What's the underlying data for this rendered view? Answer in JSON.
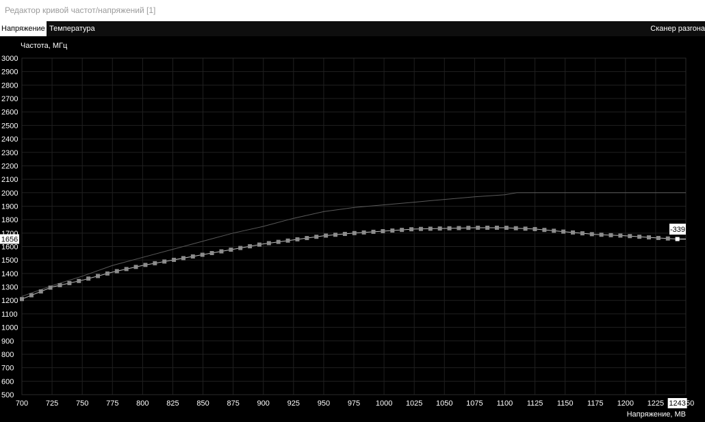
{
  "window": {
    "title": "Редактор кривой частот/напряжений [1]"
  },
  "tabs": {
    "voltage": "Напряжение",
    "temperature": "Температура",
    "scanner": "Сканер разгона"
  },
  "chart_data": {
    "type": "line",
    "ylabel": "Частота, МГц",
    "xlabel": "Напряжение, МВ",
    "xlim": [
      700,
      1250
    ],
    "ylim": [
      500,
      3000
    ],
    "x_ticks": [
      700,
      725,
      750,
      775,
      800,
      825,
      850,
      875,
      900,
      925,
      950,
      975,
      1000,
      1025,
      1050,
      1075,
      1100,
      1125,
      1150,
      1175,
      1200,
      1225,
      1250
    ],
    "y_ticks": [
      500,
      600,
      700,
      800,
      900,
      1000,
      1100,
      1200,
      1300,
      1400,
      1500,
      1600,
      1700,
      1800,
      1900,
      2000,
      2100,
      2200,
      2300,
      2400,
      2500,
      2600,
      2700,
      2800,
      2900,
      3000
    ],
    "grid": true,
    "series": [
      {
        "role": "default",
        "color": "#5a5a5a",
        "x": [
          700,
          725,
          750,
          775,
          800,
          825,
          850,
          875,
          900,
          925,
          950,
          975,
          1000,
          1025,
          1050,
          1075,
          1100,
          1110,
          1125,
          1150,
          1175,
          1200,
          1225,
          1250
        ],
        "y": [
          1230,
          1310,
          1380,
          1460,
          1520,
          1580,
          1640,
          1700,
          1750,
          1810,
          1860,
          1890,
          1910,
          1930,
          1950,
          1970,
          1985,
          2000,
          2000,
          2000,
          2000,
          2000,
          2000,
          2000
        ]
      },
      {
        "role": "curve",
        "color": "#bdbdbd",
        "point_color": "#8c8c8c",
        "x": [
          700,
          725,
          750,
          775,
          800,
          825,
          850,
          875,
          900,
          925,
          950,
          975,
          1000,
          1025,
          1050,
          1075,
          1100,
          1125,
          1150,
          1175,
          1200,
          1225,
          1243
        ],
        "y": [
          1210,
          1300,
          1350,
          1410,
          1460,
          1500,
          1540,
          1580,
          1620,
          1650,
          1680,
          1700,
          1715,
          1730,
          1735,
          1740,
          1740,
          1730,
          1710,
          1690,
          1680,
          1665,
          1656
        ]
      }
    ],
    "cursor": {
      "voltage": 1243,
      "frequency": 1656,
      "voltage_label": "1243",
      "frequency_label": "1656",
      "offset_label": "-339"
    }
  }
}
